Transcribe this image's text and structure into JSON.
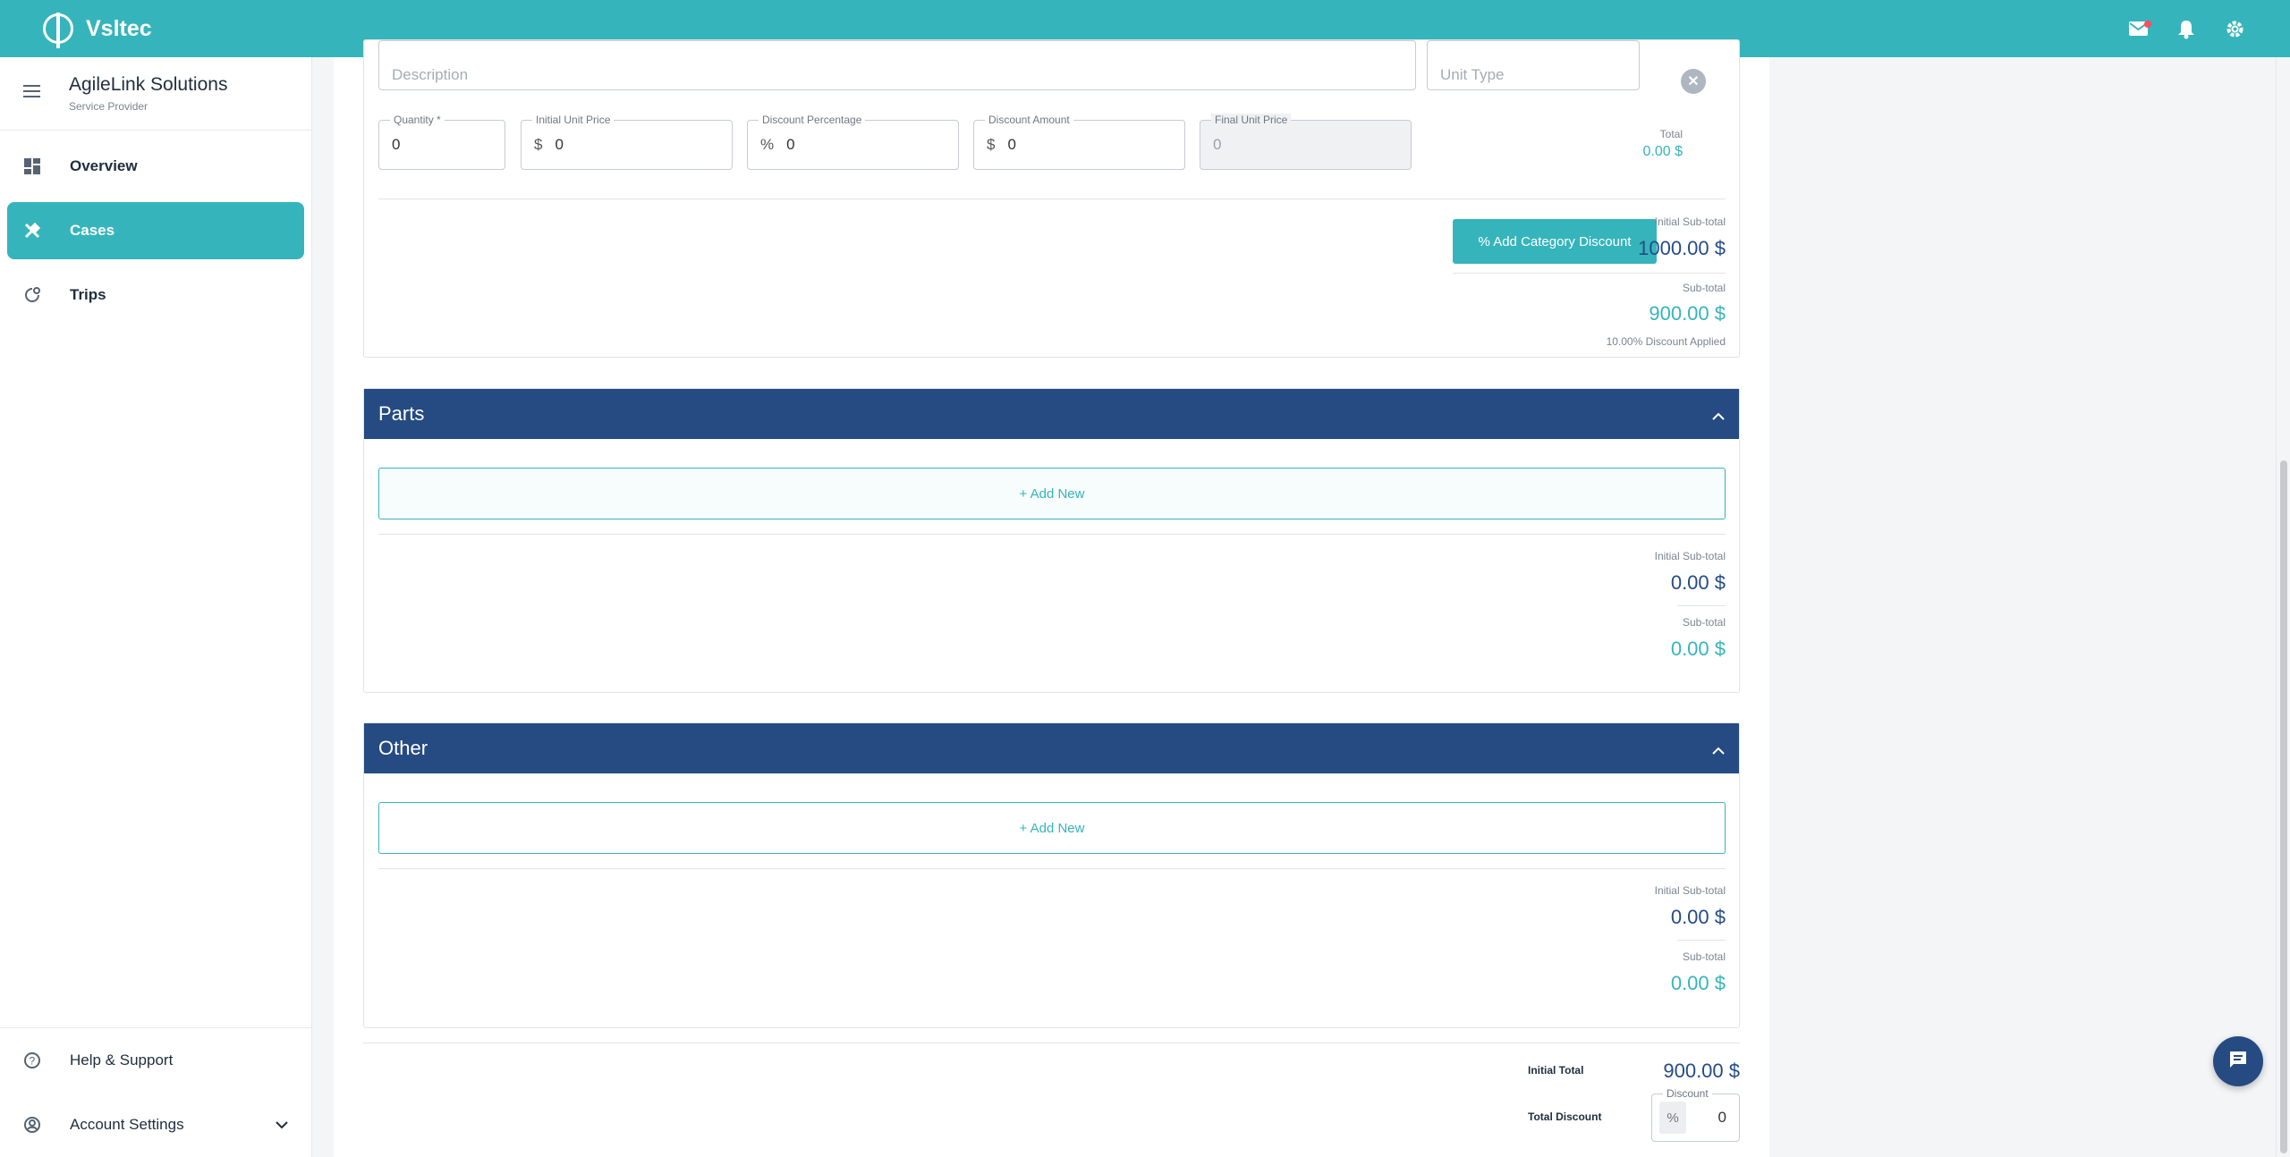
{
  "app": {
    "brand": "Vsltec"
  },
  "sidebar": {
    "company_name": "AgileLink Solutions",
    "company_role": "Service Provider",
    "items": [
      {
        "label": "Overview",
        "icon": "dashboard-icon"
      },
      {
        "label": "Cases",
        "icon": "tools-icon",
        "active": true
      },
      {
        "label": "Trips",
        "icon": "route-icon"
      }
    ],
    "help_label": "Help & Support",
    "account_label": "Account Settings"
  },
  "line_item": {
    "description_placeholder": "Description",
    "unit_type_placeholder": "Unit Type",
    "quantity_label": "Quantity *",
    "quantity_value": "0",
    "initial_price_label": "Initial Unit Price",
    "initial_price_prefix": "$",
    "initial_price_value": "0",
    "discount_pct_label": "Discount Percentage",
    "discount_pct_prefix": "%",
    "discount_pct_value": "0",
    "discount_amount_label": "Discount Amount",
    "discount_amount_prefix": "$",
    "discount_amount_value": "0",
    "final_price_label": "Final Unit Price",
    "final_price_value": "0",
    "total_label": "Total",
    "total_value": "0.00 $"
  },
  "labor_summary": {
    "add_category_discount": "% Add Category Discount",
    "initial_subtotal_label": "Initial Sub-total",
    "initial_subtotal_value": "1000.00 $",
    "subtotal_label": "Sub-total",
    "subtotal_value": "900.00 $",
    "discount_applied": "10.00% Discount Applied"
  },
  "parts": {
    "title": "Parts",
    "add_new": "+ Add New",
    "initial_subtotal_label": "Initial Sub-total",
    "initial_subtotal_value": "0.00 $",
    "subtotal_label": "Sub-total",
    "subtotal_value": "0.00 $"
  },
  "other": {
    "title": "Other",
    "add_new": "+ Add New",
    "initial_subtotal_label": "Initial Sub-total",
    "initial_subtotal_value": "0.00 $",
    "subtotal_label": "Sub-total",
    "subtotal_value": "0.00 $"
  },
  "totals": {
    "initial_total_label": "Initial Total",
    "initial_total_value": "900.00 $",
    "total_discount_label": "Total Discount",
    "discount_field_label": "Discount",
    "discount_prefix": "%",
    "discount_value": "0"
  },
  "colors": {
    "accent": "#36b4bb",
    "navy": "#254b82"
  }
}
